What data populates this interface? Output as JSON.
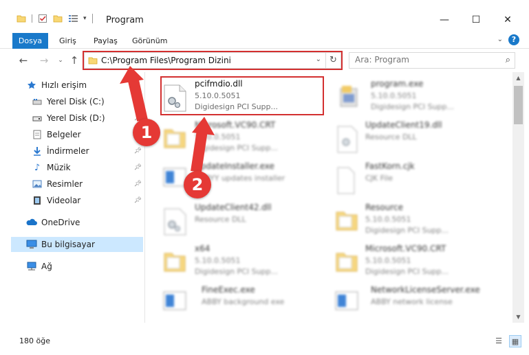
{
  "window": {
    "title": "Program",
    "minimize_icon": "—",
    "maximize_icon": "☐",
    "close_icon": "✕"
  },
  "ribbon": {
    "tabs": [
      "Dosya",
      "Giriş",
      "Paylaş",
      "Görünüm"
    ],
    "active_tab": "Dosya",
    "help_label": "?"
  },
  "nav": {
    "address_path": "C:\\Program Files\\Program Dizini",
    "search_placeholder": "Ara: Program"
  },
  "sidebar": {
    "items": [
      {
        "label": "Hızlı erişim",
        "icon": "star-icon",
        "pinned": false
      },
      {
        "label": "Yerel Disk (C:)",
        "icon": "drive-icon",
        "pinned": true
      },
      {
        "label": "Yerel Disk (D:)",
        "icon": "drive-icon",
        "pinned": true
      },
      {
        "label": "Belgeler",
        "icon": "documents-icon",
        "pinned": true
      },
      {
        "label": "İndirmeler",
        "icon": "download-icon",
        "pinned": true
      },
      {
        "label": "Müzik",
        "icon": "music-icon",
        "pinned": true
      },
      {
        "label": "Resimler",
        "icon": "pictures-icon",
        "pinned": true
      },
      {
        "label": "Videolar",
        "icon": "videos-icon",
        "pinned": true
      },
      {
        "label": "OneDrive",
        "icon": "onedrive-icon",
        "pinned": false
      },
      {
        "label": "Bu bilgisayar",
        "icon": "computer-icon",
        "pinned": false,
        "selected": true
      },
      {
        "label": "Ağ",
        "icon": "network-icon",
        "pinned": false
      }
    ]
  },
  "files": [
    {
      "name": "pcifmdio.dll",
      "line1": "5.10.0.5051",
      "line2": "Digidesign PCI Supp...",
      "icon": "dll-gear-icon",
      "highlighted": true
    },
    {
      "name": "program.exe",
      "line1": "5.10.0.5051",
      "line2": "Digidesign PCI Supp...",
      "icon": "exe-icon"
    },
    {
      "name": "Microsoft.VC90.CRT",
      "line1": "5.10.0.5051",
      "line2": "Digidesign PCI Supp...",
      "icon": "folder-icon"
    },
    {
      "name": "UpdateClient19.dll",
      "line1": "Resource DLL",
      "line2": "",
      "icon": "dll-icon"
    },
    {
      "name": "UpdateInstaller.exe",
      "line1": "ABBYY updates installer",
      "line2": "",
      "icon": "app-window-icon"
    },
    {
      "name": "FastKorn.cjk",
      "line1": "CJK File",
      "line2": "",
      "icon": "file-icon"
    },
    {
      "name": "UpdateClient42.dll",
      "line1": "Resource DLL",
      "line2": "",
      "icon": "dll-gear-icon"
    },
    {
      "name": "Resource",
      "line1": "5.10.0.5051",
      "line2": "Digidesign PCI Supp...",
      "icon": "folder-icon"
    },
    {
      "name": "x64",
      "line1": "5.10.0.5051",
      "line2": "Digidesign PCI Supp...",
      "icon": "folder-icon"
    },
    {
      "name": "Microsoft.VC90.CRT",
      "line1": "5.10.0.5051",
      "line2": "Digidesign PCI Supp...",
      "icon": "folder-icon"
    },
    {
      "name": "FineExec.exe",
      "line1": "ABBY background exe",
      "line2": "",
      "icon": "app-window-icon"
    },
    {
      "name": "NetworkLicenseServer.exe",
      "line1": "ABBY network license",
      "line2": "",
      "icon": "app-window-icon"
    }
  ],
  "status": {
    "item_count": "180 öğe"
  },
  "annotations": {
    "badge1": "1",
    "badge2": "2",
    "color": "#e53935"
  }
}
